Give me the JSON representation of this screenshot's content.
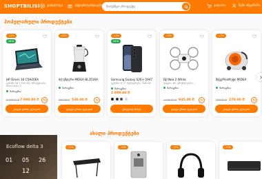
{
  "header": {
    "logo": "SHOPTBILISI",
    "catalog_label": "კატალოგი",
    "offers_label": "აქციები/ფასდაკლება",
    "search_placeholder": "მოძებნეთ პროდუქტი",
    "cart_label": "კალათა",
    "account_label": "ჩემი ანგარიში"
  },
  "sections": {
    "popular_title": "პოპულარული პროდუქტები",
    "new_title": "ახალი პროდუქტები"
  },
  "products": [
    {
      "badge_pct": "-12%",
      "badge_new": "NEW",
      "name": "HP Omen 16 C5H20EA",
      "desc": "ეკრანი 16.1 Full HD, პროცესორი: Intel Core i7...",
      "stock": "მარაგშია",
      "old_price": "8 499.00 ₾",
      "new_price": "7 099.00 ₾",
      "buy_label": "ყიდვა ერთი კლიკით"
    },
    {
      "badge_pct": "-18%",
      "badge_new": "",
      "name": "ბლენდერი MIDEA BL3516A",
      "desc": "",
      "stock": "მარაგშია",
      "old_price": "599.00 ₾",
      "new_price": "539.00 ₾",
      "buy_label": "ყიდვა ერთი კლიკით"
    },
    {
      "badge_pct": "-15%",
      "badge_new": "NEW",
      "name": "Samsung Galaxy S26+ 5947",
      "desc": "ეკრანი: 6.7\", მეხსიერება: 256 GB",
      "stock": "მარაგშია",
      "old_price": "",
      "new_price": "2 899.00 ₾",
      "buy_label": "ვრცლად ნახვა"
    },
    {
      "badge_pct": "-15%",
      "badge_new": "",
      "name": "DJI Neo 2 White",
      "desc": "ვიდეო: 4K, ფრენის დრო...",
      "stock": "მარაგშია",
      "old_price": "1 099.00 ₾",
      "new_price": "935.00 ₾",
      "buy_label": "ყიდვა ერთი კლიკით"
    },
    {
      "badge_pct": "-15%",
      "badge_new": "",
      "name": "მტვერსასრუტი MIDEA",
      "desc": "",
      "stock": "მარაგშია",
      "old_price": "359.00 ₾",
      "new_price": "279.00 ₾",
      "buy_label": "ყიდვა ერთი კლიკით"
    }
  ],
  "colors": [
    "#1a1a1a",
    "#2f2f3a",
    "#444f66",
    "#d9d9d9"
  ],
  "promo": {
    "title": "Ecoflow delta 3",
    "countdown": [
      "01",
      "05",
      "26",
      "12"
    ]
  },
  "new_products": [
    {
      "badge_pct": "-12%"
    },
    {
      "badge_pct": "-15%"
    },
    {
      "badge_pct": "-15%"
    },
    {
      "badge_pct": "-15%"
    }
  ]
}
